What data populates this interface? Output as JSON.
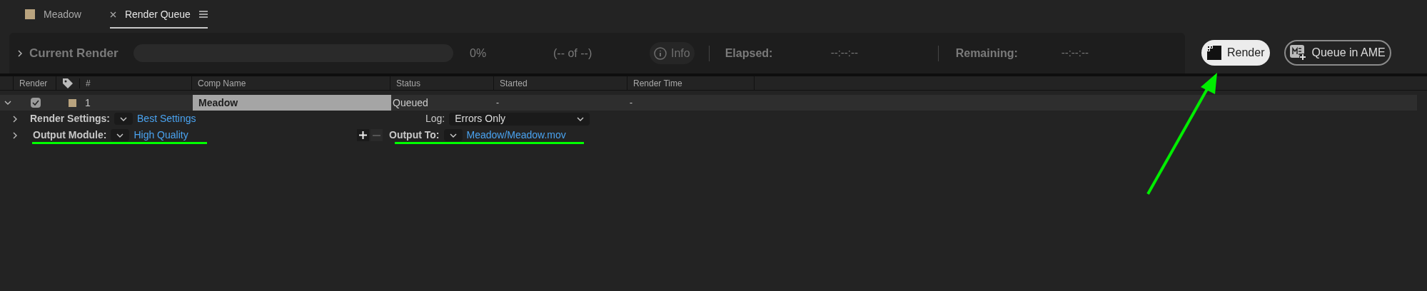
{
  "tabs": [
    {
      "label": "Meadow",
      "selected": false,
      "kind": "comp"
    },
    {
      "label": "Render Queue",
      "selected": true,
      "kind": "panel"
    }
  ],
  "current_render": {
    "expanded": false,
    "title": "Current Render",
    "level": 0,
    "percent": "0%",
    "count": "(-- of --)",
    "info": "Info",
    "elapsed_label": "Elapsed:",
    "elapsed": "--:--:--",
    "remaining_label": "Remaining:",
    "remaining": "--:--:--"
  },
  "buttons": [
    {
      "label": "Render",
      "kind": "primary"
    },
    {
      "label": "Queue in AME",
      "kind": "secondary"
    }
  ],
  "table": {
    "columns": [
      "Render",
      "#",
      "Comp Name",
      "Status",
      "Started",
      "Render Time"
    ],
    "rows": [
      {
        "expanded": true,
        "checked": true,
        "number": "1",
        "comp_name": "Meadow",
        "selected": true,
        "status": "Queued",
        "started": "-",
        "render_time": "-",
        "settings": [
          {
            "expanded": false,
            "label": "Render Settings:",
            "value": "Best Settings",
            "side_label": "Log:",
            "side_value": "Errors Only",
            "kind": "log"
          },
          {
            "expanded": false,
            "label": "Output Module:",
            "value": "High Quality",
            "side_label": "Output To:",
            "side_value": "Meadow/Meadow.mov",
            "kind": "output"
          }
        ]
      }
    ]
  }
}
